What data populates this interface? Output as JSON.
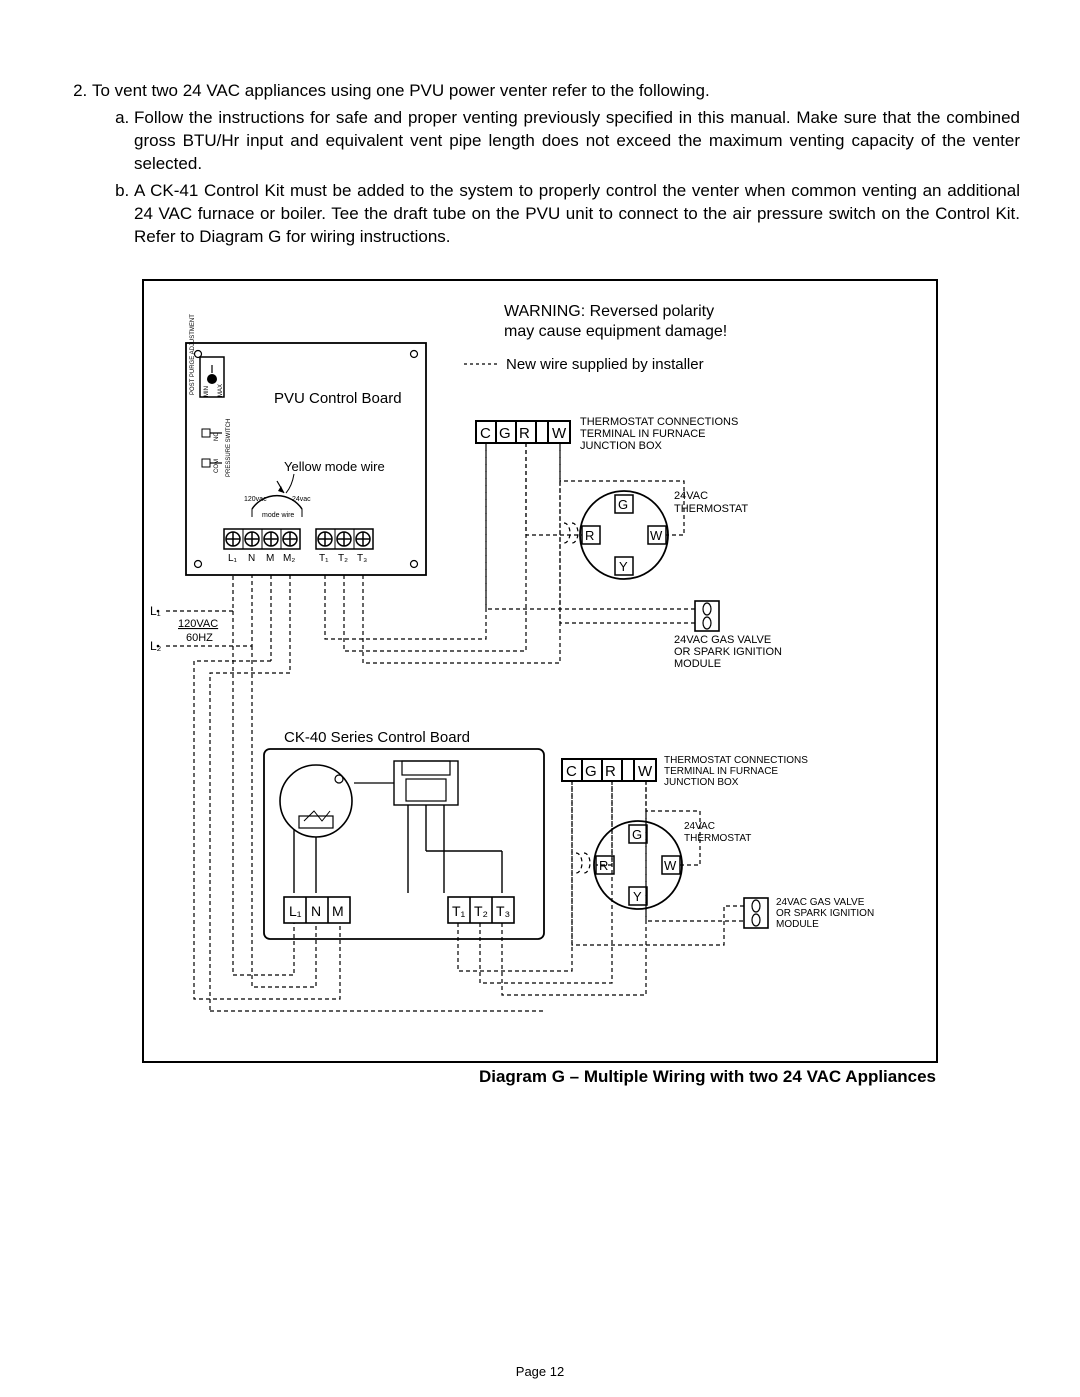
{
  "instructions": {
    "item2": "To vent two 24 VAC appliances using one PVU power venter refer to the following.",
    "item2a": "Follow the instructions for safe and proper venting previously specified in this manual. Make sure that the combined gross BTU/Hr input and equivalent vent pipe length does not exceed the maximum venting capacity of the venter selected.",
    "item2b": "A CK-41 Control Kit must be added to the system to properly control the venter when common venting an additional 24 VAC furnace or boiler. Tee the draft tube on the PVU unit to connect to the air pressure switch on the Control Kit. Refer to Diagram G for wiring instructions."
  },
  "diagram": {
    "caption": "Diagram G – Multiple Wiring with two 24 VAC Appliances",
    "warning_l1": "WARNING: Reversed polarity",
    "warning_l2": "may cause equipment damage!",
    "legend": "New wire supplied by installer",
    "pvu_board": "PVU Control Board",
    "yellow_mode": "Yellow mode wire",
    "mode_wire": "mode wire",
    "v120": "120vac",
    "v24": "24vac",
    "post_purge": "POST PURGE ADJUSTMENT",
    "min": "MIN",
    "max": "MAX",
    "nc": "NC",
    "com": "COM",
    "pressure_switch": "PRESSURE SWITCH",
    "terminals_pvu_left": [
      "L₁",
      "N",
      "M",
      "M₂"
    ],
    "terminals_pvu_right": [
      "T₁",
      "T₂",
      "T₃"
    ],
    "l1": "L₁",
    "l2": "L₂",
    "power_l1": "120VAC",
    "power_l2": "60HZ",
    "tstat_conn_l1": "THERMOSTAT CONNECTIONS",
    "tstat_conn_l2": "TERMINAL IN FURNACE",
    "tstat_conn_l3": "JUNCTION BOX",
    "tstat_terms": [
      "C",
      "G",
      "R",
      "W"
    ],
    "thermo_24_l1": "24VAC",
    "thermo_24_l2": "THERMOSTAT",
    "thermo_terms": [
      "G",
      "R",
      "W",
      "Y"
    ],
    "gas_valve_l1": "24VAC GAS VALVE",
    "gas_valve_l2": "OR SPARK IGNITION",
    "gas_valve_l3": "MODULE",
    "ck40_board": "CK-40 Series Control Board",
    "ck40_left": [
      "L₁",
      "N",
      "M"
    ],
    "ck40_right": [
      "T₁",
      "T₂",
      "T₃"
    ]
  },
  "footer": "Page 12"
}
